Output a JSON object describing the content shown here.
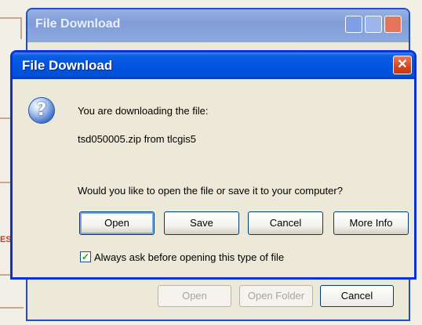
{
  "back_window": {
    "title": "File Download",
    "buttons": {
      "open": "Open",
      "open_folder": "Open Folder",
      "cancel": "Cancel"
    }
  },
  "dialog": {
    "title": "File Download",
    "message": "You are downloading the file:",
    "file": "tsd050005.zip from tlcgis5",
    "question": "Would you like to open the file or save it to your computer?",
    "buttons": {
      "open": "Open",
      "save": "Save",
      "cancel": "Cancel",
      "more_info": "More Info"
    },
    "checkbox_label": "Always ask before opening this type of file",
    "checkbox_checked": true
  },
  "icons": {
    "question": "question-icon",
    "close": "close-icon",
    "check": "checkmark-icon"
  },
  "colors": {
    "titlebar": "#0054e3",
    "window_bg": "#ece9d8",
    "close": "#d4461f",
    "border": "#0831d9"
  }
}
